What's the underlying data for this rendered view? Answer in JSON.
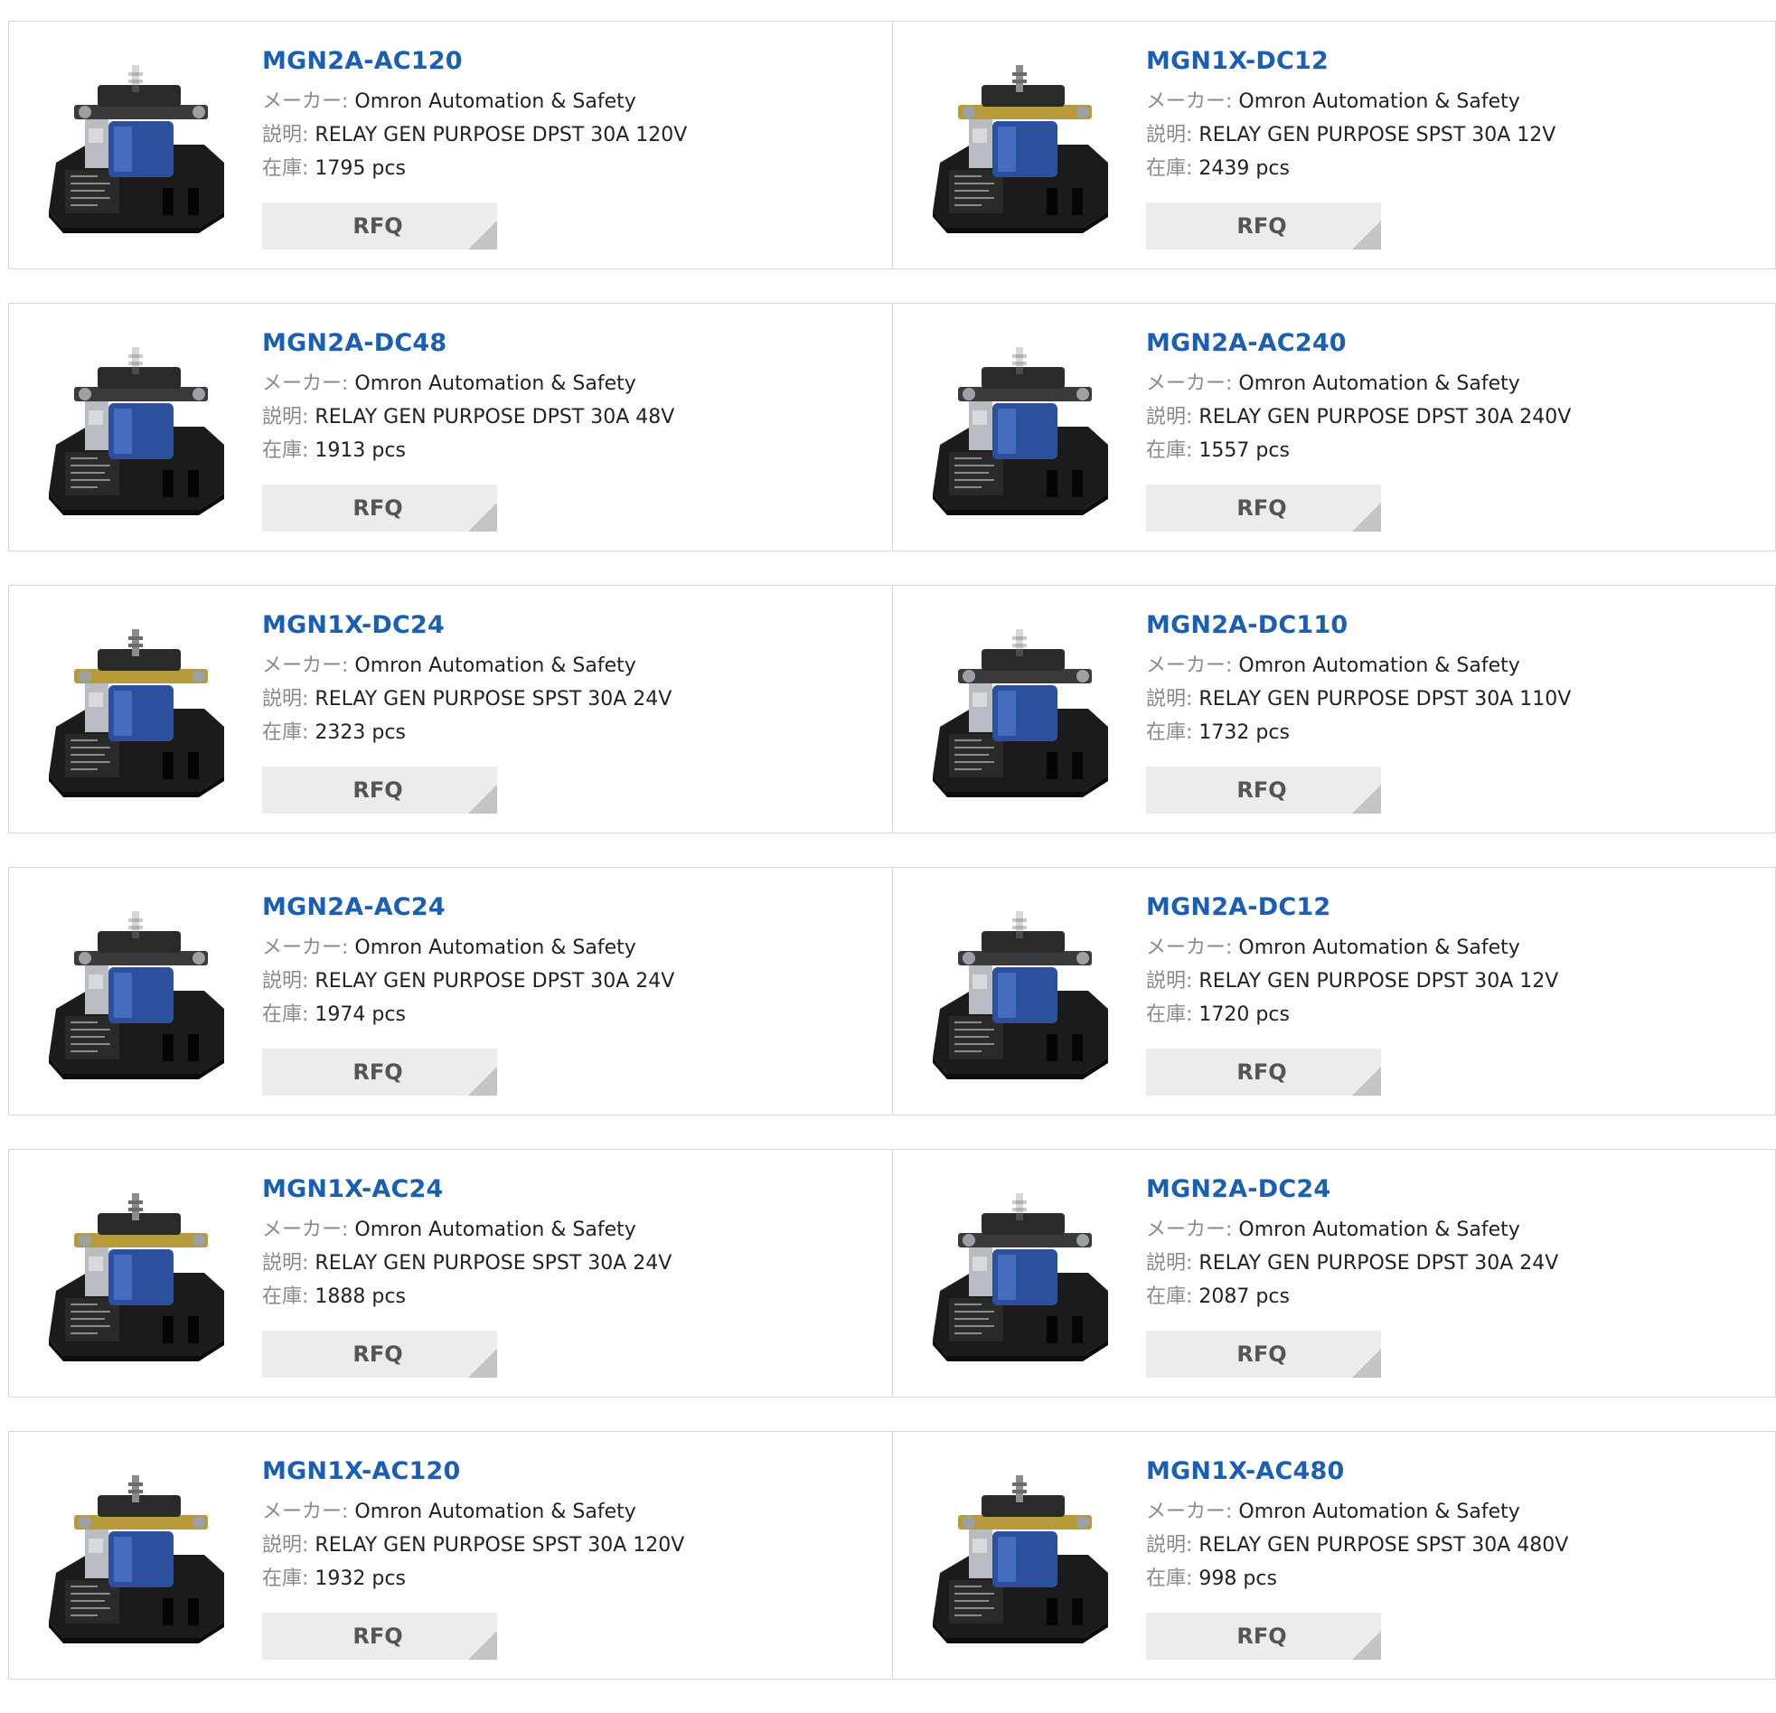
{
  "labels": {
    "maker": "メーカー:",
    "description": "説明:",
    "stock": "在庫:",
    "rfq": "RFQ"
  },
  "products": [
    {
      "part": "MGN2A-AC120",
      "maker": "Omron Automation & Safety",
      "description": "RELAY GEN PURPOSE DPST 30A 120V",
      "stock": "1795 pcs",
      "image": "relay-dpst"
    },
    {
      "part": "MGN1X-DC12",
      "maker": "Omron Automation & Safety",
      "description": "RELAY GEN PURPOSE SPST 30A 12V",
      "stock": "2439 pcs",
      "image": "relay-spst"
    },
    {
      "part": "MGN2A-DC48",
      "maker": "Omron Automation & Safety",
      "description": "RELAY GEN PURPOSE DPST 30A 48V",
      "stock": "1913 pcs",
      "image": "relay-dpst"
    },
    {
      "part": "MGN2A-AC240",
      "maker": "Omron Automation & Safety",
      "description": "RELAY GEN PURPOSE DPST 30A 240V",
      "stock": "1557 pcs",
      "image": "relay-dpst"
    },
    {
      "part": "MGN1X-DC24",
      "maker": "Omron Automation & Safety",
      "description": "RELAY GEN PURPOSE SPST 30A 24V",
      "stock": "2323 pcs",
      "image": "relay-spst"
    },
    {
      "part": "MGN2A-DC110",
      "maker": "Omron Automation & Safety",
      "description": "RELAY GEN PURPOSE DPST 30A 110V",
      "stock": "1732 pcs",
      "image": "relay-dpst"
    },
    {
      "part": "MGN2A-AC24",
      "maker": "Omron Automation & Safety",
      "description": "RELAY GEN PURPOSE DPST 30A 24V",
      "stock": "1974 pcs",
      "image": "relay-dpst"
    },
    {
      "part": "MGN2A-DC12",
      "maker": "Omron Automation & Safety",
      "description": "RELAY GEN PURPOSE DPST 30A 12V",
      "stock": "1720 pcs",
      "image": "relay-dpst"
    },
    {
      "part": "MGN1X-AC24",
      "maker": "Omron Automation & Safety",
      "description": "RELAY GEN PURPOSE SPST 30A 24V",
      "stock": "1888 pcs",
      "image": "relay-spst"
    },
    {
      "part": "MGN2A-DC24",
      "maker": "Omron Automation & Safety",
      "description": "RELAY GEN PURPOSE DPST 30A 24V",
      "stock": "2087 pcs",
      "image": "relay-dpst"
    },
    {
      "part": "MGN1X-AC120",
      "maker": "Omron Automation & Safety",
      "description": "RELAY GEN PURPOSE SPST 30A 120V",
      "stock": "1932 pcs",
      "image": "relay-spst"
    },
    {
      "part": "MGN1X-AC480",
      "maker": "Omron Automation & Safety",
      "description": "RELAY GEN PURPOSE SPST 30A 480V",
      "stock": "998 pcs",
      "image": "relay-spst"
    }
  ],
  "colors": {
    "title_link": "#1a5fb4",
    "label_gray": "#8a8a8a",
    "rfq_bg": "#ececec",
    "border": "#d6d6d6"
  }
}
